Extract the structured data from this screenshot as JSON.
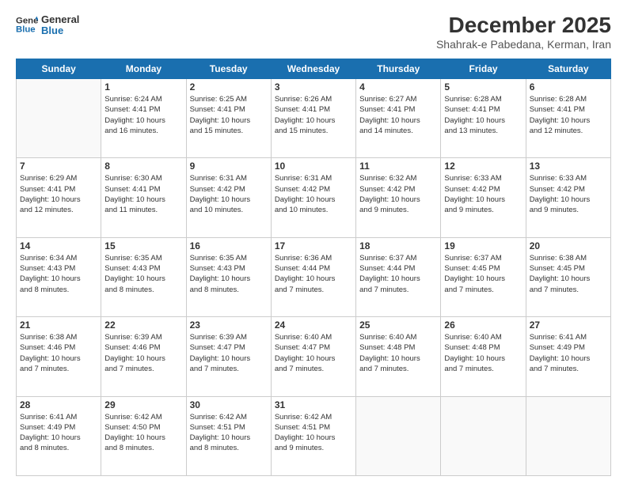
{
  "logo": {
    "line1": "General",
    "line2": "Blue"
  },
  "title": "December 2025",
  "subtitle": "Shahrak-e Pabedana, Kerman, Iran",
  "header_days": [
    "Sunday",
    "Monday",
    "Tuesday",
    "Wednesday",
    "Thursday",
    "Friday",
    "Saturday"
  ],
  "weeks": [
    [
      {
        "day": "",
        "info": ""
      },
      {
        "day": "1",
        "info": "Sunrise: 6:24 AM\nSunset: 4:41 PM\nDaylight: 10 hours\nand 16 minutes."
      },
      {
        "day": "2",
        "info": "Sunrise: 6:25 AM\nSunset: 4:41 PM\nDaylight: 10 hours\nand 15 minutes."
      },
      {
        "day": "3",
        "info": "Sunrise: 6:26 AM\nSunset: 4:41 PM\nDaylight: 10 hours\nand 15 minutes."
      },
      {
        "day": "4",
        "info": "Sunrise: 6:27 AM\nSunset: 4:41 PM\nDaylight: 10 hours\nand 14 minutes."
      },
      {
        "day": "5",
        "info": "Sunrise: 6:28 AM\nSunset: 4:41 PM\nDaylight: 10 hours\nand 13 minutes."
      },
      {
        "day": "6",
        "info": "Sunrise: 6:28 AM\nSunset: 4:41 PM\nDaylight: 10 hours\nand 12 minutes."
      }
    ],
    [
      {
        "day": "7",
        "info": "Sunrise: 6:29 AM\nSunset: 4:41 PM\nDaylight: 10 hours\nand 12 minutes."
      },
      {
        "day": "8",
        "info": "Sunrise: 6:30 AM\nSunset: 4:41 PM\nDaylight: 10 hours\nand 11 minutes."
      },
      {
        "day": "9",
        "info": "Sunrise: 6:31 AM\nSunset: 4:42 PM\nDaylight: 10 hours\nand 10 minutes."
      },
      {
        "day": "10",
        "info": "Sunrise: 6:31 AM\nSunset: 4:42 PM\nDaylight: 10 hours\nand 10 minutes."
      },
      {
        "day": "11",
        "info": "Sunrise: 6:32 AM\nSunset: 4:42 PM\nDaylight: 10 hours\nand 9 minutes."
      },
      {
        "day": "12",
        "info": "Sunrise: 6:33 AM\nSunset: 4:42 PM\nDaylight: 10 hours\nand 9 minutes."
      },
      {
        "day": "13",
        "info": "Sunrise: 6:33 AM\nSunset: 4:42 PM\nDaylight: 10 hours\nand 9 minutes."
      }
    ],
    [
      {
        "day": "14",
        "info": "Sunrise: 6:34 AM\nSunset: 4:43 PM\nDaylight: 10 hours\nand 8 minutes."
      },
      {
        "day": "15",
        "info": "Sunrise: 6:35 AM\nSunset: 4:43 PM\nDaylight: 10 hours\nand 8 minutes."
      },
      {
        "day": "16",
        "info": "Sunrise: 6:35 AM\nSunset: 4:43 PM\nDaylight: 10 hours\nand 8 minutes."
      },
      {
        "day": "17",
        "info": "Sunrise: 6:36 AM\nSunset: 4:44 PM\nDaylight: 10 hours\nand 7 minutes."
      },
      {
        "day": "18",
        "info": "Sunrise: 6:37 AM\nSunset: 4:44 PM\nDaylight: 10 hours\nand 7 minutes."
      },
      {
        "day": "19",
        "info": "Sunrise: 6:37 AM\nSunset: 4:45 PM\nDaylight: 10 hours\nand 7 minutes."
      },
      {
        "day": "20",
        "info": "Sunrise: 6:38 AM\nSunset: 4:45 PM\nDaylight: 10 hours\nand 7 minutes."
      }
    ],
    [
      {
        "day": "21",
        "info": "Sunrise: 6:38 AM\nSunset: 4:46 PM\nDaylight: 10 hours\nand 7 minutes."
      },
      {
        "day": "22",
        "info": "Sunrise: 6:39 AM\nSunset: 4:46 PM\nDaylight: 10 hours\nand 7 minutes."
      },
      {
        "day": "23",
        "info": "Sunrise: 6:39 AM\nSunset: 4:47 PM\nDaylight: 10 hours\nand 7 minutes."
      },
      {
        "day": "24",
        "info": "Sunrise: 6:40 AM\nSunset: 4:47 PM\nDaylight: 10 hours\nand 7 minutes."
      },
      {
        "day": "25",
        "info": "Sunrise: 6:40 AM\nSunset: 4:48 PM\nDaylight: 10 hours\nand 7 minutes."
      },
      {
        "day": "26",
        "info": "Sunrise: 6:40 AM\nSunset: 4:48 PM\nDaylight: 10 hours\nand 7 minutes."
      },
      {
        "day": "27",
        "info": "Sunrise: 6:41 AM\nSunset: 4:49 PM\nDaylight: 10 hours\nand 7 minutes."
      }
    ],
    [
      {
        "day": "28",
        "info": "Sunrise: 6:41 AM\nSunset: 4:49 PM\nDaylight: 10 hours\nand 8 minutes."
      },
      {
        "day": "29",
        "info": "Sunrise: 6:42 AM\nSunset: 4:50 PM\nDaylight: 10 hours\nand 8 minutes."
      },
      {
        "day": "30",
        "info": "Sunrise: 6:42 AM\nSunset: 4:51 PM\nDaylight: 10 hours\nand 8 minutes."
      },
      {
        "day": "31",
        "info": "Sunrise: 6:42 AM\nSunset: 4:51 PM\nDaylight: 10 hours\nand 9 minutes."
      },
      {
        "day": "",
        "info": ""
      },
      {
        "day": "",
        "info": ""
      },
      {
        "day": "",
        "info": ""
      }
    ]
  ]
}
